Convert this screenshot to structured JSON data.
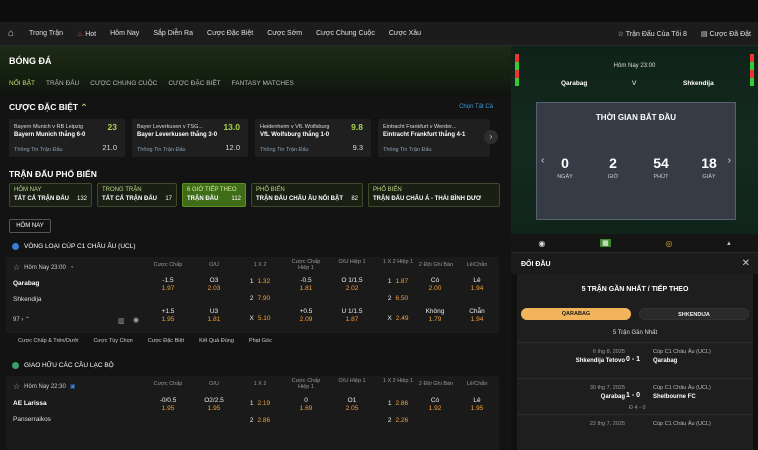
{
  "nav": {
    "items": [
      "Trong Trận",
      "Hot",
      "Hôm Nay",
      "Sắp Diễn Ra",
      "Cược Đặc Biệt",
      "Cược Sớm",
      "Cược Chung Cuộc",
      "Cược Xâu"
    ],
    "my_matches": "Trận Đấu Của Tôi",
    "my_matches_count": "8",
    "placed_bets": "Cược Đã Đặt"
  },
  "hero": {
    "title": "BÓNG ĐÁ",
    "tabs": [
      "NỔI BẬT",
      "TRẬN ĐẤU",
      "CƯỢC CHUNG CUỘC",
      "CƯỢC ĐẶC BIỆT",
      "FANTASY MATCHES"
    ]
  },
  "special": {
    "title": "CƯỢC ĐẶC BIỆT",
    "view_all": "Chọn Tất Cả",
    "cards": [
      {
        "match": "Bayern Munich v RB Leipzig",
        "bet": "Bayern Munich thắng 6-0",
        "odds": "23",
        "old": "21.0",
        "info": "Thông Tin Trận Đấu"
      },
      {
        "match": "Bayer Leverkusen v TSG...",
        "bet": "Bayer Leverkusen thắng 3-0",
        "odds": "13.0",
        "old": "12.0",
        "info": "Thông Tin Trận Đấu"
      },
      {
        "match": "Heidenheim v VfL Wolfsburg",
        "bet": "VfL Wolfsburg thắng 1-0",
        "odds": "9.8",
        "old": "9.3",
        "info": "Thông Tin Trận Đấu"
      },
      {
        "match": "Eintracht Frankfurt v Werder...",
        "bet": "Eintracht Frankfurt thắng 4-1",
        "odds": "",
        "old": "",
        "info": "Thông Tin Trận Đấu"
      }
    ]
  },
  "popular": {
    "title": "TRẬN ĐẤU PHỔ BIẾN",
    "items": [
      {
        "t1": "HÔM NAY",
        "t2": "TẤT CẢ TRẬN ĐẤU",
        "count": "132"
      },
      {
        "t1": "TRONG TRẬN",
        "t2": "TẤT CẢ TRẬN ĐẤU",
        "count": "17"
      },
      {
        "t1": "6 GIỜ TIẾP THEO",
        "t2": "TRẬN ĐẤU",
        "count": "112"
      },
      {
        "t1": "PHỔ BIẾN",
        "t2": "TRẬN ĐẤU CHÂU ÂU NỔI BẬT",
        "count": "82"
      },
      {
        "t1": "PHỔ BIẾN",
        "t2": "TRẬN ĐẤU CHÂU Á - THÁI BÌNH DƯƠ",
        "count": ""
      }
    ],
    "today_pill": "HÔM NAY"
  },
  "columns": [
    "Cược Chấp",
    "O/U",
    "1 X 2",
    "Cược Chấp Hiệp 1",
    "O/U Hiệp 1",
    "1 X 2 Hiệp 1",
    "2 Đội Ghi Bàn",
    "Lẻ/Chẵn"
  ],
  "league1": {
    "name": "VÒNG LOẠI CÚP C1 CHÂU ÂU (UCL)",
    "time": "Hôm Nay 23:00",
    "home": "Qarabag",
    "away": "Shkendija",
    "more": "97",
    "row1": [
      [
        "-1.5",
        "1.97"
      ],
      [
        "O3",
        "2.03"
      ],
      [
        "1",
        "1.32"
      ],
      [
        "-0.5",
        "1.81"
      ],
      [
        "O 1/1.5",
        "2.02"
      ],
      [
        "1",
        "1.87"
      ],
      [
        "Có",
        "2.00"
      ],
      [
        "Lẻ",
        "1.94"
      ]
    ],
    "draw": [
      "2",
      "7.90"
    ],
    "draw_h1": [
      "2",
      "6.50"
    ],
    "row2": [
      [
        "+1.5",
        "1.95"
      ],
      [
        "U3",
        "1.81"
      ],
      [
        "X",
        "5.10"
      ],
      [
        "+0.5",
        "2.09"
      ],
      [
        "U 1/1.5",
        "1.87"
      ],
      [
        "X",
        "2.49"
      ],
      [
        "Không",
        "1.79"
      ],
      [
        "Chẵn",
        "1.94"
      ]
    ],
    "filters": [
      "Cược Chấp & Trên/Dưới",
      "Cược Tùy Chọn",
      "Cược Đặc Biệt",
      "Kết Quả Đúng",
      "Phạt Góc"
    ]
  },
  "league2": {
    "name": "GIAO HỮU CÁC CÂU LẠC BỘ",
    "time": "Hôm Nay 22:30",
    "home": "AE Larissa",
    "away": "Panserraikos",
    "row1": [
      [
        "-0/0.5",
        "1.95"
      ],
      [
        "O2/2.5",
        "1.95"
      ],
      [
        "1",
        "2.19"
      ],
      [
        "0",
        "1.69"
      ],
      [
        "O1",
        "2.05"
      ],
      [
        "1",
        "2.86"
      ],
      [
        "Có",
        "1.92"
      ],
      [
        "Lẻ",
        "1.95"
      ]
    ],
    "row2": [
      [
        "",
        ""
      ],
      [
        "",
        ""
      ],
      [
        "2",
        "2.86"
      ],
      [
        "",
        ""
      ],
      [
        "",
        ""
      ],
      [
        "2",
        "2.26"
      ],
      [
        "",
        ""
      ],
      [
        "",
        ""
      ]
    ]
  },
  "match_panel": {
    "time": "Hôm Nay 23:00",
    "home": "Qarabag",
    "vs": "V",
    "away": "Shkendija",
    "countdown_title": "THỜI GIAN BẮT ĐẦU",
    "countdown": [
      {
        "value": "0",
        "unit": "NGÀY"
      },
      {
        "value": "2",
        "unit": "GIỜ"
      },
      {
        "value": "54",
        "unit": "PHÚT"
      },
      {
        "value": "18",
        "unit": "GIÂY"
      }
    ]
  },
  "h2h": {
    "title": "ĐỐI ĐẦU",
    "subtitle": "5 TRẬN GẦN NHẤT / TIẾP THEO",
    "tab_home": "QARABAG",
    "tab_away": "SHKENDIJA",
    "recent_label": "5 Trận Gần Nhất",
    "games": [
      {
        "date": "6 thg 8, 2025",
        "home": "Shkendija Tetovo",
        "score": "0 - 1",
        "comp": "Cúp C1 Châu Âu (UCL)",
        "away": "Qarabag",
        "ht": ""
      },
      {
        "date": "30 thg 7, 2025",
        "home": "Qarabag",
        "score": "1 - 0",
        "comp": "Cúp C1 Châu Âu (UCL)",
        "away": "Shelbourne FC",
        "ht": "Đ 4 - 0"
      },
      {
        "date": "22 thg 7, 2025",
        "home": "",
        "score": "",
        "comp": "Cúp C1 Châu Âu (UCL)",
        "away": "",
        "ht": ""
      }
    ]
  }
}
